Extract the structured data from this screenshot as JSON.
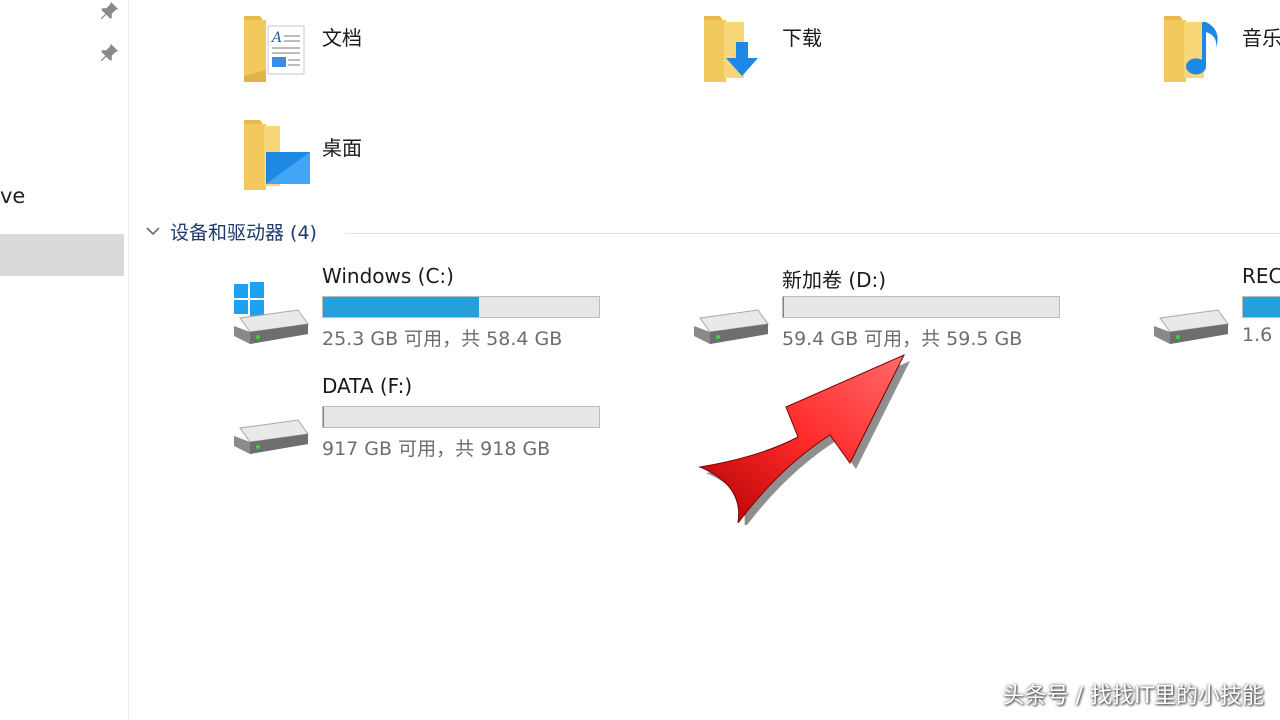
{
  "sidebar": {
    "partial_label": "ve"
  },
  "folders": [
    {
      "label": "文档",
      "icon": "documents-folder-icon"
    },
    {
      "label": "下载",
      "icon": "downloads-folder-icon"
    },
    {
      "label": "音乐",
      "icon": "music-folder-icon"
    },
    {
      "label": "桌面",
      "icon": "desktop-folder-icon"
    }
  ],
  "devices_section": {
    "title": "设备和驱动器 (4)"
  },
  "drives": [
    {
      "name": "Windows (C:)",
      "space": "25.3 GB 可用，共 58.4 GB",
      "used_fraction": 0.567,
      "icon": "windows-drive-icon"
    },
    {
      "name": "新加卷 (D:)",
      "space": "59.4 GB 可用，共 59.5 GB",
      "used_fraction": 0.002,
      "icon": "drive-icon"
    },
    {
      "name": "REC",
      "space": "1.6",
      "used_fraction": 1.0,
      "icon": "drive-icon"
    },
    {
      "name": "DATA (F:)",
      "space": "917 GB 可用，共 918 GB",
      "used_fraction": 0.001,
      "icon": "drive-icon"
    }
  ],
  "colors": {
    "usage_bar": "#26a0da",
    "selection": "#d9d9d9",
    "section_title": "#1e3b6e",
    "annotation_arrow": "#e01010"
  },
  "watermark": "头条号 / 找找IT里的小技能"
}
